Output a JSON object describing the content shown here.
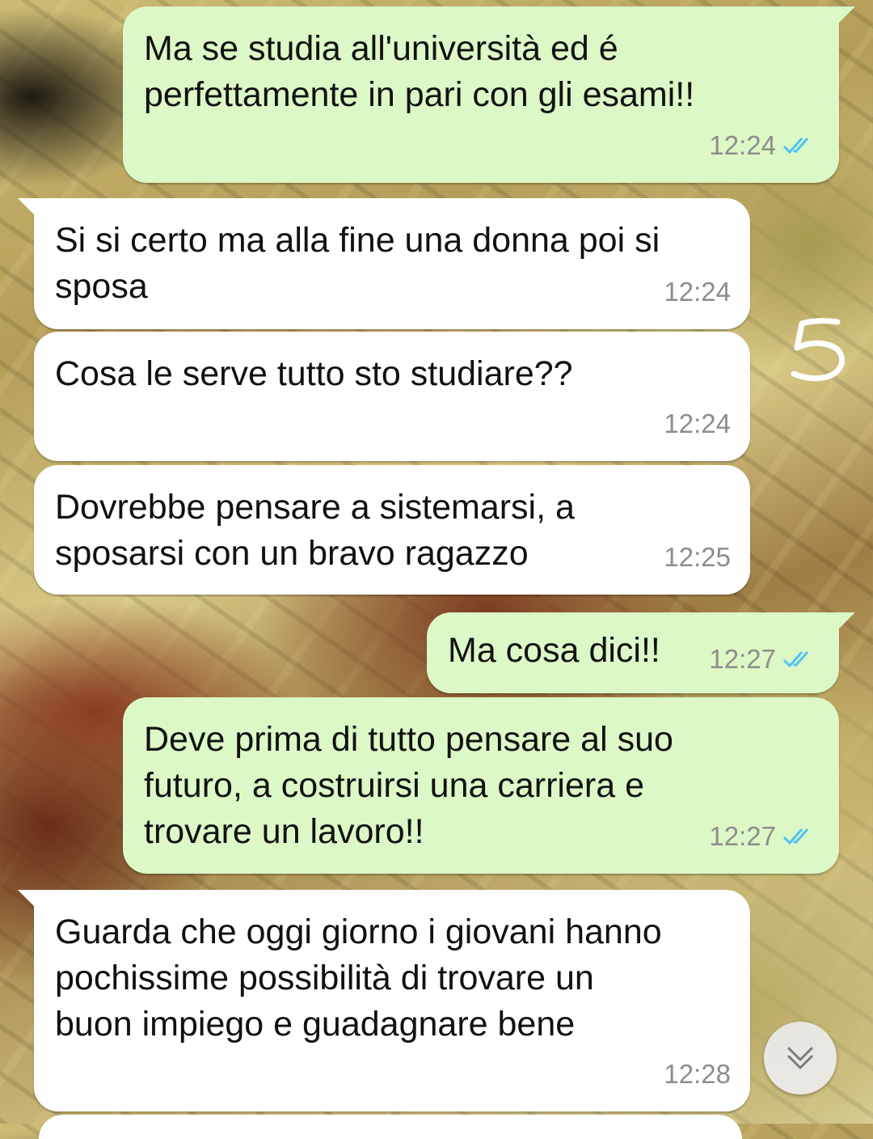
{
  "messages": [
    {
      "direction": "outgoing",
      "text": "Ma se studia all'università ed é\nperfettamente in pari con gli esami!!",
      "time": "12:24",
      "status": "read"
    },
    {
      "direction": "incoming",
      "text": "Si si certo ma alla fine una donna poi si\nsposa",
      "time": "12:24"
    },
    {
      "direction": "incoming",
      "text": "Cosa le serve tutto sto studiare??",
      "time": "12:24"
    },
    {
      "direction": "incoming",
      "text": "Dovrebbe pensare a sistemarsi, a\nsposarsi con un bravo ragazzo",
      "time": "12:25"
    },
    {
      "direction": "outgoing",
      "text": "Ma cosa dici!!",
      "time": "12:27",
      "status": "read"
    },
    {
      "direction": "outgoing",
      "text": "Deve prima di tutto pensare al suo\nfuturo, a costruirsi una carriera e\ntrovare un lavoro!!",
      "time": "12:27",
      "status": "read"
    },
    {
      "direction": "incoming",
      "text": "Guarda che oggi giorno i giovani hanno\npochissime possibilità di trovare un\nbuon impiego e guadagnare bene",
      "time": "12:28"
    }
  ],
  "annotation": {
    "text": "5",
    "style": "handwritten-number"
  },
  "icons": {
    "read_receipt": "double-check-icon",
    "scroll_down": "double-chevron-down-icon"
  },
  "colors": {
    "outgoing_bubble": "#dcf8c6",
    "incoming_bubble": "#ffffff",
    "read_tick": "#4fc3f7",
    "timestamp": "#8d8d8d"
  }
}
